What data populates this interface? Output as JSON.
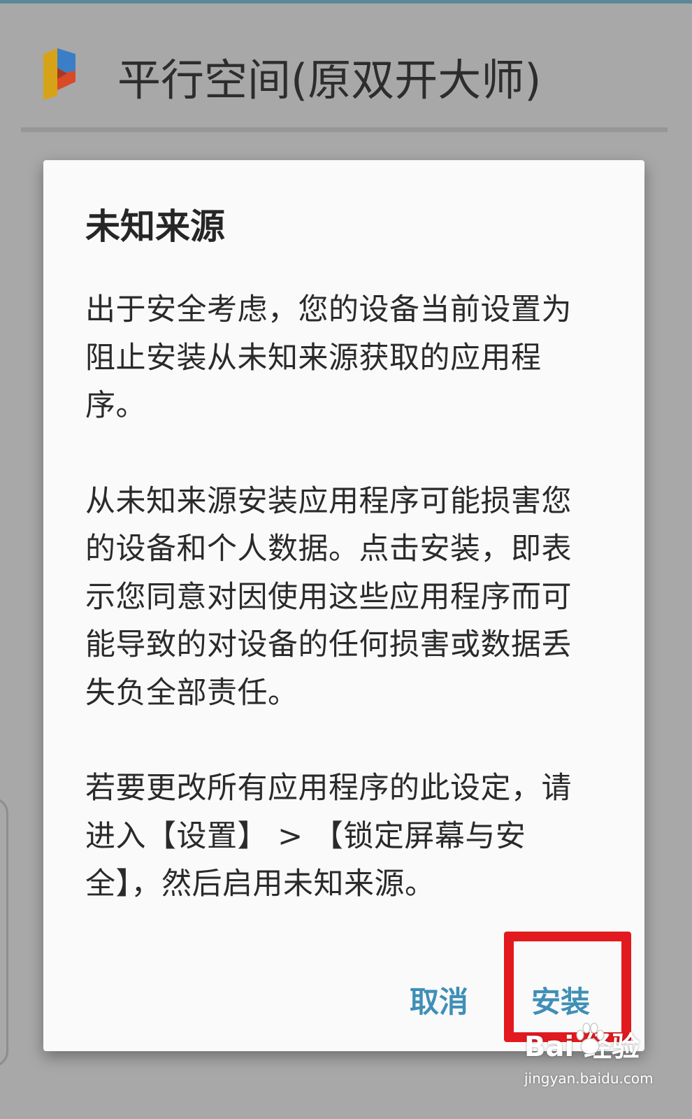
{
  "app": {
    "title": "平行空间(原双开大师)",
    "icon": "parallel-space-logo-icon",
    "colors": {
      "icon_yellow": "#d6a318",
      "icon_blue": "#3a7fc6",
      "icon_red": "#d94a28"
    }
  },
  "dialog": {
    "title": "未知来源",
    "paragraphs": [
      "出于安全考虑，您的设备当前设置为阻止安装从未知来源获取的应用程序。",
      "从未知来源安装应用程序可能损害您的设备和个人数据。点击安装，即表示您同意对因使用这些应用程序而可能导致的对设备的任何损害或数据丢失负全部责任。",
      "若要更改所有应用程序的此设定，请进入【设置】 > 【锁定屏幕与安全】，然后启用未知来源。"
    ],
    "buttons": {
      "cancel": "取消",
      "install": "安装"
    },
    "colors": {
      "button_text": "#3f8fb6",
      "highlight": "#e2191e"
    }
  },
  "watermark": {
    "brand": "Bai  经验",
    "url": "jingyan.baidu.com",
    "icon": "baidu-paw-icon"
  }
}
